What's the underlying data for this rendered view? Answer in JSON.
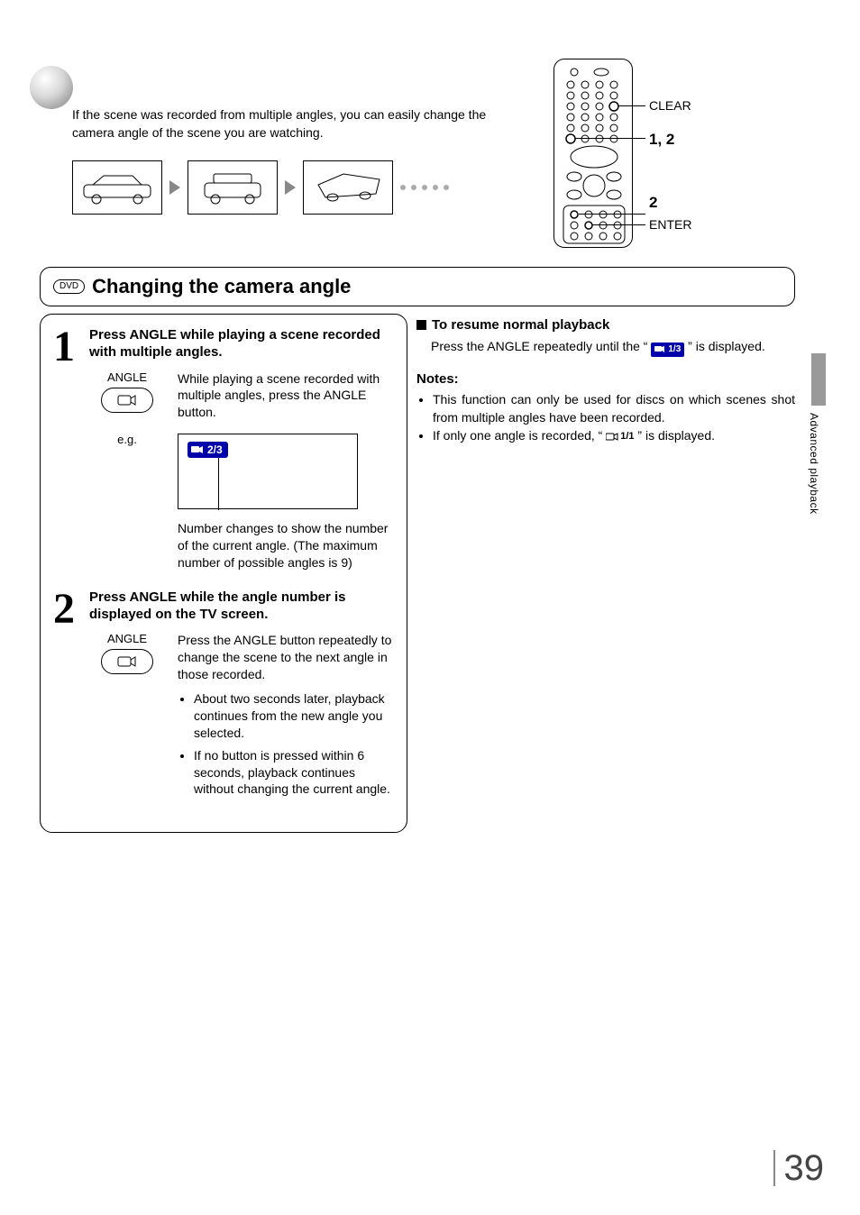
{
  "intro": "If the scene was recorded from multiple angles, you can easily change the camera angle of the scene you are watching.",
  "remote": {
    "clear": "CLEAR",
    "s12": "1, 2",
    "s2": "2",
    "enter": "ENTER"
  },
  "dvd_badge": "DVD",
  "section_title": "Changing the camera angle",
  "step1": {
    "num": "1",
    "head": "Press ANGLE while playing a scene recorded with multiple angles.",
    "btn_label": "ANGLE",
    "desc": "While playing a scene recorded with multiple angles, press the ANGLE button.",
    "eg": "e.g.",
    "osd": "2/3",
    "osd_cap": "Number changes to show the number of the current angle. (The maximum number of possible angles is 9)"
  },
  "step2": {
    "num": "2",
    "head": "Press ANGLE while the angle number is displayed on the TV screen.",
    "btn_label": "ANGLE",
    "desc": "Press the ANGLE button repeatedly to change the scene to the next angle in those recorded.",
    "b1": "About two seconds later, playback continues from the new angle you selected.",
    "b2": "If no button is pressed within 6 seconds, playback continues without changing the current angle."
  },
  "resume": {
    "head": "To resume normal playback",
    "p1a": "Press the ANGLE repeatedly until the “",
    "chip": "1/3",
    "p1b": "” is displayed."
  },
  "notes": {
    "head": "Notes:",
    "n1": "This function can only be used for discs on which scenes shot from multiple angles have been recorded.",
    "n2a": "If only one angle is recorded, “",
    "n2_icon": "1/1",
    "n2b": "” is displayed."
  },
  "side_tab": "Advanced playback",
  "page_number": "39"
}
